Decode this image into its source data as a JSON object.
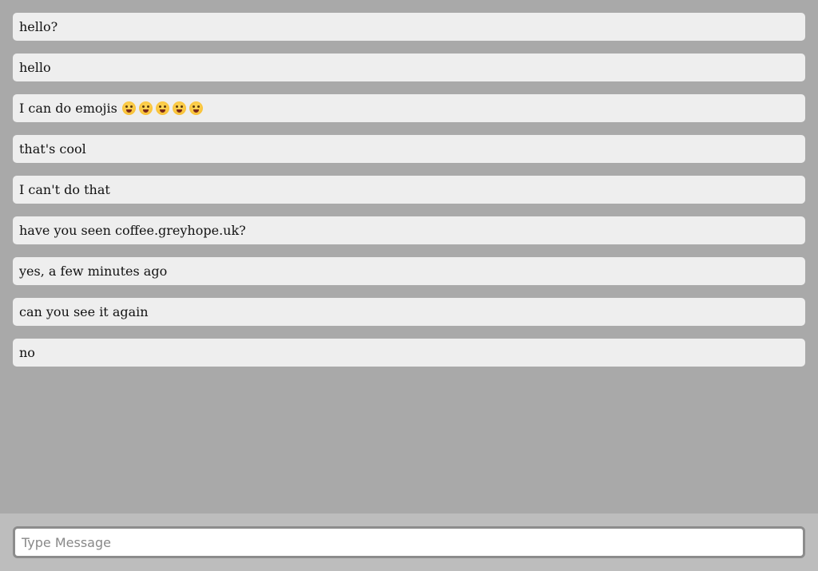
{
  "messages": [
    {
      "text": "hello?"
    },
    {
      "text": "hello"
    },
    {
      "text": "I can do emojis",
      "emojis": [
        "tongue-out-emoji",
        "squinting-tongue-emoji",
        "winking-tongue-emoji",
        "zany-face-emoji",
        "raised-eyebrow-emoji"
      ]
    },
    {
      "text": "that's cool"
    },
    {
      "text": "I can't do that"
    },
    {
      "text": "have you seen coffee.greyhope.uk?"
    },
    {
      "text": "yes, a few minutes ago"
    },
    {
      "text": "can you see it again"
    },
    {
      "text": "no"
    }
  ],
  "composer": {
    "placeholder": "Type Message",
    "value": ""
  },
  "colors": {
    "chat_background": "#a9a9a9",
    "message_background": "#eeeeee",
    "composer_background": "#bdbdbd",
    "emoji_yellow": "#f6b92b"
  }
}
